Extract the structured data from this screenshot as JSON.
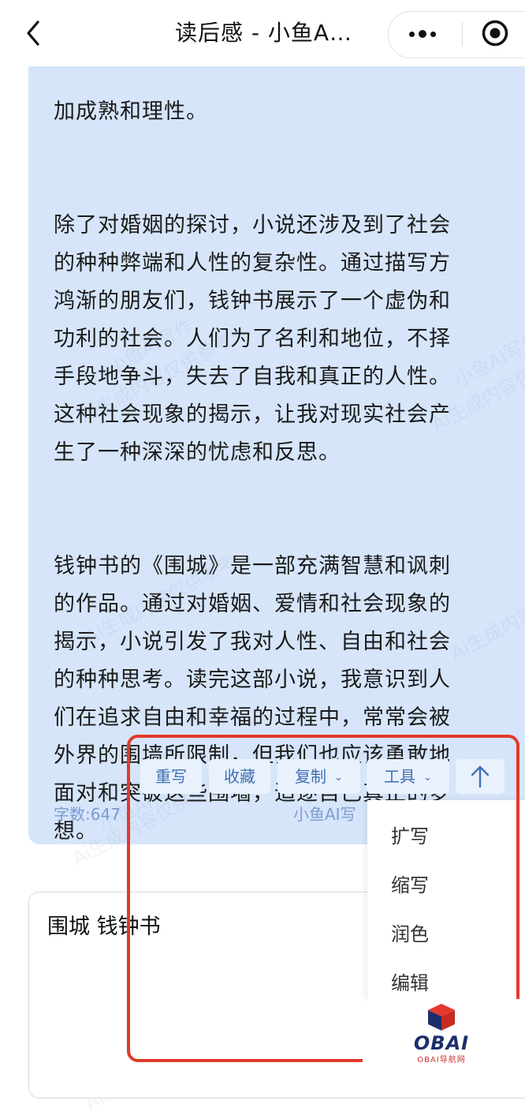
{
  "header": {
    "title": "读后感 - 小鱼A…"
  },
  "article": {
    "paragraphs": [
      "加成熟和理性。",
      "除了对婚姻的探讨，小说还涉及到了社会\n的种种弊端和人性的复杂性。通过描写方\n鸿渐的朋友们，钱钟书展示了一个虚伪和\n功利的社会。人们为了名利和地位，不择\n手段地争斗，失去了自我和真正的人性。\n这种社会现象的揭示，让我对现实社会产\n生了一种深深的忧虑和反思。",
      "钱钟书的《围城》是一部充满智慧和讽刺\n的作品。通过对婚姻、爱情和社会现象的\n揭示，小说引发了我对人性、自由和社会\n的种种思考。读完这部小说，我意识到人\n们在追求自由和幸福的过程中，常常会被\n外界的围墙所限制，但我们也应该勇敢地\n面对和突破这些围墙，追逐自己真正的梦\n想。"
    ]
  },
  "actions": {
    "rewrite": "重写",
    "favorite": "收藏",
    "copy": "复制",
    "tools": "工具"
  },
  "footer": {
    "word_count": "字数:647",
    "brand": "小鱼AI写"
  },
  "tools_menu": {
    "items": [
      "扩写",
      "缩写",
      "润色",
      "编辑"
    ]
  },
  "input": {
    "value": "围城 钱钟书"
  },
  "watermarks": {
    "line1": "小鱼AI写作",
    "line2": "Ai生成内容仅供参考"
  },
  "logo": {
    "main": "OBAI",
    "sub": "OBAI导航网"
  },
  "colors": {
    "bubble": "#d6e5fa",
    "button_bg": "#e9f1fc",
    "button_text": "#3f6fb5",
    "highlight": "#e23a2a"
  },
  "icons": {
    "back": "chevron-left-icon",
    "more": "more-dots-icon",
    "close_target": "target-circle-icon",
    "scroll_top": "arrow-up-icon",
    "dropdown": "chevron-down-icon"
  }
}
